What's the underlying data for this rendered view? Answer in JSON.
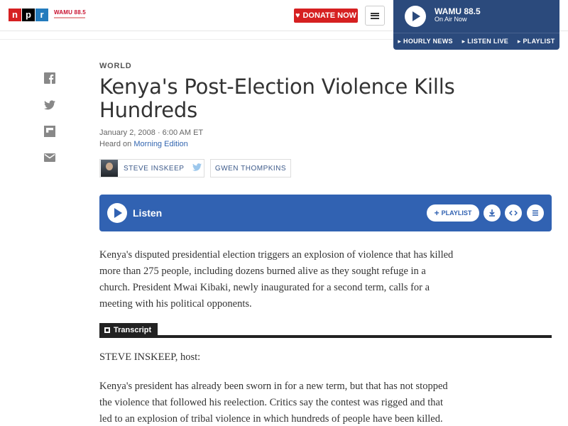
{
  "header": {
    "logo_letters": [
      "n",
      "p",
      "r"
    ],
    "station_logo": "WAMU 88.5",
    "donate_label": "DONATE NOW",
    "menu_icon": "hamburger-icon"
  },
  "station_player": {
    "title": "WAMU 88.5",
    "status": "On Air Now",
    "links": [
      "HOURLY NEWS",
      "LISTEN LIVE",
      "PLAYLIST"
    ]
  },
  "share": [
    "facebook-icon",
    "twitter-icon",
    "flipboard-icon",
    "email-icon"
  ],
  "article": {
    "section": "WORLD",
    "headline": "Kenya's Post-Election Violence Kills Hundreds",
    "date": "January 2, 2008 · 6:00 AM ET",
    "heard_prefix": "Heard on ",
    "program": "Morning Edition",
    "bylines": [
      "STEVE INSKEEP",
      "GWEN THOMPKINS"
    ]
  },
  "player": {
    "label": "Listen",
    "playlist_label": "PLAYLIST"
  },
  "teaser": "Kenya's disputed presidential election triggers an explosion of violence that has killed more than 275 people, including dozens burned alive as they sought refuge in a church. President Mwai Kibaki, newly inaugurated for a second term, calls for a meeting with his political opponents.",
  "transcript": {
    "label": "Transcript",
    "speaker": "STEVE INSKEEP, host:",
    "paragraph": "Kenya's president has already been sworn in for a new term, but that has not stopped the violence that followed his reelection. Critics say the contest was rigged and that led to an explosion of tribal violence in which hundreds of people have been killed."
  },
  "colors": {
    "npr_red": "#d62021",
    "npr_blue": "#237bbd",
    "player_blue": "#3162b2",
    "station_blue": "#2b4a7c",
    "link_blue": "#3366b0"
  }
}
